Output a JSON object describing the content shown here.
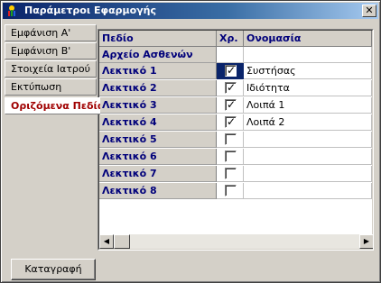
{
  "window": {
    "title": "Παράμετροι Εφαρμογής",
    "close_label": "✕"
  },
  "tabs": [
    {
      "label": "Εμφάνιση Α'",
      "active": false
    },
    {
      "label": "Εμφάνιση Β'",
      "active": false
    },
    {
      "label": "Στοιχεία Ιατρού",
      "active": false
    },
    {
      "label": "Εκτύπωση",
      "active": false
    },
    {
      "label": "Οριζόμενα Πεδία",
      "active": true
    }
  ],
  "grid": {
    "columns": [
      "Πεδίο",
      "Χρ.",
      "Ονομασία"
    ],
    "group_label": "Αρχείο Ασθενών",
    "rows": [
      {
        "field": "Λεκτικό 1",
        "checked": true,
        "name": "Συστήσας",
        "focused": true
      },
      {
        "field": "Λεκτικό 2",
        "checked": true,
        "name": "Ιδιότητα"
      },
      {
        "field": "Λεκτικό 3",
        "checked": true,
        "name": "Λοιπά 1"
      },
      {
        "field": "Λεκτικό 4",
        "checked": true,
        "name": "Λοιπά 2"
      },
      {
        "field": "Λεκτικό 5",
        "checked": false,
        "name": ""
      },
      {
        "field": "Λεκτικό 6",
        "checked": false,
        "name": ""
      },
      {
        "field": "Λεκτικό 7",
        "checked": false,
        "name": ""
      },
      {
        "field": "Λεκτικό 8",
        "checked": false,
        "name": ""
      }
    ],
    "check_mark": "✓",
    "scroll_left": "◀",
    "scroll_right": "▶"
  },
  "footer": {
    "save_label": "Καταγραφή"
  },
  "colors": {
    "title_start": "#0a246a",
    "title_end": "#a6caf0",
    "header_text": "#00007a",
    "active_tab_text": "#a00000"
  }
}
